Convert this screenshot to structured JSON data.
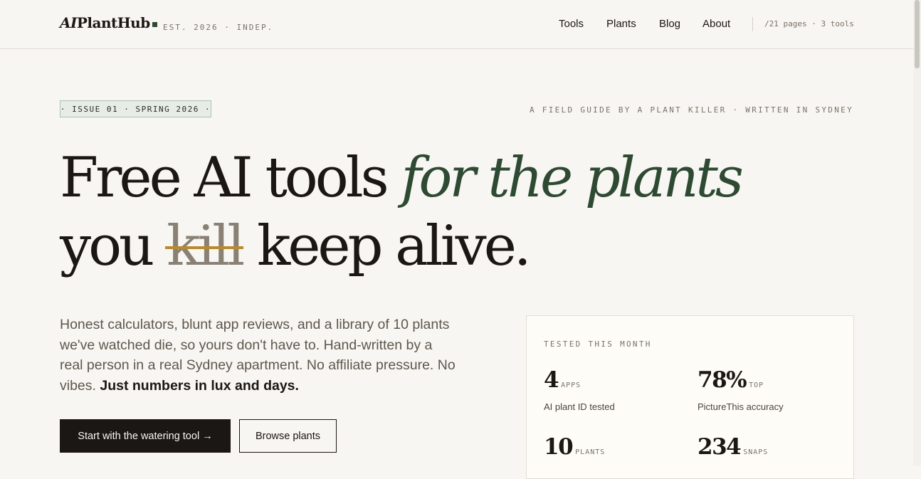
{
  "header": {
    "logo_ai": "AI",
    "logo_rest": "PlantHub",
    "tagline": "EST. 2026 · INDEP.",
    "nav": [
      {
        "label": "Tools"
      },
      {
        "label": "Plants"
      },
      {
        "label": "Blog"
      },
      {
        "label": "About"
      }
    ],
    "stats_line": "/21 pages · 3 tools"
  },
  "hero": {
    "issue_badge": "· ISSUE 01 · SPRING 2026 ·",
    "kicker": "A FIELD GUIDE BY A PLANT KILLER · WRITTEN IN SYDNEY",
    "headline_line1_plain": "Free AI tools ",
    "headline_line1_accent": "for the plants",
    "headline_line2_start": "you ",
    "headline_line2_struck": "kill",
    "headline_line2_end": " keep alive.",
    "lede_plain": "Honest calculators, blunt app reviews, and a library of 10 plants we've watched die, so yours don't have to. Hand-written by a real person in a real Sydney apartment. No affiliate pressure. No vibes. ",
    "lede_bold": "Just numbers in lux and days.",
    "primary_button": "Start with the watering tool →",
    "secondary_button": "Browse plants"
  },
  "stats_card": {
    "title": "TESTED THIS MONTH",
    "stats": [
      {
        "value": "4",
        "unit": "APPS",
        "label": "AI plant ID tested"
      },
      {
        "value": "78%",
        "unit": "TOP",
        "label": "PictureThis accuracy"
      },
      {
        "value": "10",
        "unit": "PLANTS",
        "label": ""
      },
      {
        "value": "234",
        "unit": "SNAPS",
        "label": ""
      }
    ]
  },
  "colors": {
    "background": "#f8f6f2",
    "ink": "#1b1714",
    "accent_green": "#2e4a33",
    "strike_gold": "#b8892e",
    "badge_bg": "#e7ede6"
  }
}
